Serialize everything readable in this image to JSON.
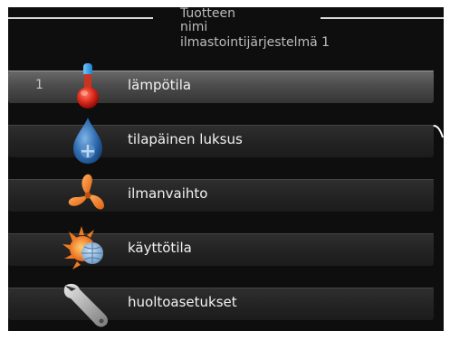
{
  "header": {
    "line1": "Tuotteen",
    "line2": "nimi",
    "subtitle": "ilmastointijärjestelmä 1"
  },
  "menu": {
    "items": [
      {
        "number": "1",
        "label": "lämpötila",
        "icon": "thermometer-icon",
        "selected": true
      },
      {
        "number": "",
        "label": "tilapäinen luksus",
        "icon": "water-drop-icon",
        "selected": false
      },
      {
        "number": "",
        "label": "ilmanvaihto",
        "icon": "fan-icon",
        "selected": false
      },
      {
        "number": "",
        "label": "käyttötila",
        "icon": "sun-globe-icon",
        "selected": false
      },
      {
        "number": "",
        "label": "huoltoasetukset",
        "icon": "wrench-icon",
        "selected": false
      }
    ]
  },
  "colors": {
    "background": "#0e0e0e",
    "bar": "#2a2a2a",
    "selected_bar": "#5a5a5a",
    "text": "#f2f2f2"
  }
}
